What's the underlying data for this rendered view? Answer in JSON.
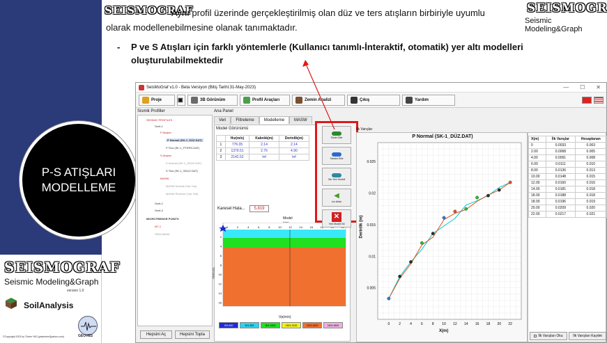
{
  "slide": {
    "brand": "SEISMOGRAF",
    "brand_sub": "Seismic Modeling&Graph",
    "intro_text_1": "Aynı profil üzerinde gerçekleştirilmiş olan düz ve ters atışların birbiriyle uyumlu",
    "intro_text_2": "olarak modellenebilmesine olanak tanımaktadır.",
    "bullet_dash": "-",
    "bullet_text_1": "P ve S Atışları için farklı yöntemlerle (Kullanıcı tanımlı-İnteraktif, otomatik)  yer altı modelleri",
    "bullet_text_2": "oluşturulabilmektedir",
    "circle_line_1": "P-S ATIŞLARI",
    "circle_line_2": "MODELLEME",
    "logo_brand": "SEISMOGRAF",
    "logo_sub": "Seismic Modeling&Graph",
    "logo_version": "version 1.0",
    "soil_label": "SoilAnalysis",
    "geoves": "GEOVES",
    "copyright": "©Copyright 2023 by Türker YAS (yasturker@yahoo.com)"
  },
  "app": {
    "title": "SeisMoGraf v1.0 - Beta Versiyon (Bitiş Tarihi:31-May-2023)",
    "toolbar": [
      "Proje",
      "3B Görünüm",
      "Profil Araçları",
      "Zemin Analizi",
      "Çıkış",
      "Yardım"
    ],
    "left_panel_title": "Sismik Profiller",
    "tree": [
      "SEISMIC PROFILES",
      "Serit-1",
      "P Atışları",
      "P Normal (SK-1_DÜZ.DAT)",
      "P Ters (SK-1_PTERS.DAT)",
      "S Atışları",
      "S Normal (SK-1_SDUZ.DAT)",
      "S Ters (SK-1_SDUZ.DAT)",
      "MASW",
      "MASW Normal (Yok Yok)",
      "MASW Reverse (Yok Yok)",
      "Serit-2",
      "Serit-3",
      "MICROTREMOR POINTS",
      "MT-1",
      "SPAC/MAM"
    ],
    "left_buttons": [
      "Hepsini Aç",
      "Hepsini Topla"
    ],
    "main_panel_title": "Ana Panel",
    "tabs": [
      "Veri",
      "Filtreleme",
      "Modelleme",
      "MASW"
    ],
    "model_view_title": "Model Görünümü",
    "table_headers": [
      "",
      "Hız(m/s)",
      "Kalınlık(m)",
      "Derinlik(m)"
    ],
    "table_rows": [
      [
        "1",
        "776.05",
        "2.14",
        "2.14"
      ],
      [
        "2",
        "1379.51",
        "2.76",
        "4.90"
      ],
      [
        "3",
        "2142.52",
        "Inf",
        "Inf"
      ]
    ],
    "error_label": "Karesel Hata...",
    "error_value": "5.819",
    "side_buttons": [
      "Sinde Ekle",
      "Tabaka Ekle",
      "Otu Yeni Modeli",
      "Ion Aktar",
      "Yeni Modeli Sil"
    ],
    "model_title": "Model",
    "model_xlabel": "X(m)",
    "model_ylabel": "Metre(m)",
    "model_bottom_label": "Vp(m/s)",
    "model_x_ticks": [
      "0",
      "2",
      "4",
      "6",
      "8",
      "10",
      "12",
      "14",
      "16",
      "18",
      "20",
      "22"
    ],
    "model_y_ticks": [
      "2",
      "4",
      "6",
      "8",
      "10",
      "12",
      "14",
      "16"
    ],
    "legend": [
      {
        "label": "200-600",
        "color": "#1e2ad4"
      },
      {
        "label": "601-800",
        "color": "#2ad4f0"
      },
      {
        "label": "801-1500",
        "color": "#22e022"
      },
      {
        "label": "1501-2100",
        "color": "#f0f020"
      },
      {
        "label": "2100-2400",
        "color": "#f07030"
      },
      {
        "label": "2400-2600",
        "color": "#f0b0e0"
      }
    ],
    "arrivals_title": "İlk Varışlar",
    "right_table_headers": [
      "X(m)",
      "İlk Varışlar",
      "Hesaplanan"
    ],
    "right_table_rows": [
      [
        "0",
        "0.0033",
        "0.003"
      ],
      [
        "2.00",
        "0.0068",
        "0.005"
      ],
      [
        "4.00",
        "0.0091",
        "0.008"
      ],
      [
        "6.00",
        "0.0111",
        "0.010"
      ],
      [
        "8.00",
        "0.0136",
        "0.013"
      ],
      [
        "10.00",
        "0.0148",
        "0.015"
      ],
      [
        "12.00",
        "0.0160",
        "0.016"
      ],
      [
        "14.00",
        "0.0181",
        "0.018"
      ],
      [
        "18.00",
        "0.0188",
        "0.018"
      ],
      [
        "18.00",
        "0.0196",
        "0.019"
      ],
      [
        "20.00",
        "0.0209",
        "0.020"
      ],
      [
        "22.00",
        "0.0217",
        "0.021"
      ]
    ],
    "right_buttons": [
      "İlk Varışları Oku",
      "İlk Varışları Kaydet"
    ]
  },
  "chart_data": {
    "type": "line",
    "title": "P  Normal  (SK-1_DÜZ.DAT)",
    "xlabel": "X(m)",
    "ylabel": "Derinlik (m)",
    "xlim": [
      -2,
      24
    ],
    "ylim": [
      0,
      0.028
    ],
    "x_ticks": [
      0,
      2,
      4,
      6,
      8,
      10,
      12,
      14,
      16,
      18,
      20,
      22
    ],
    "y_ticks": [
      0.005,
      0.01,
      0.015,
      0.02,
      0.025
    ],
    "grid": true,
    "series": [
      {
        "color": "#00c8c8",
        "x": [
          0,
          2,
          4,
          6,
          8,
          10,
          12,
          14,
          16,
          18,
          20,
          22
        ],
        "y": [
          0.0033,
          0.0068,
          0.0091,
          0.0111,
          0.0136,
          0.0148,
          0.016,
          0.0181,
          0.0188,
          0.0196,
          0.0209,
          0.0217
        ]
      },
      {
        "color": "#e05020",
        "x": [
          0,
          2,
          4,
          6,
          8,
          10,
          12,
          14,
          16,
          18,
          20,
          22
        ],
        "y": [
          0.0033,
          0.0065,
          0.0088,
          0.0118,
          0.013,
          0.0158,
          0.0168,
          0.0174,
          0.0187,
          0.0197,
          0.0205,
          0.0217
        ]
      }
    ],
    "markers": [
      {
        "x": 0,
        "y": 0.0033,
        "color": "#2a7ad8"
      },
      {
        "x": 2,
        "y": 0.0068,
        "color": "#2a2a2a"
      },
      {
        "x": 4,
        "y": 0.0091,
        "color": "#2a2a2a"
      },
      {
        "x": 6,
        "y": 0.0121,
        "color": "#22c022"
      },
      {
        "x": 8,
        "y": 0.0136,
        "color": "#2a2a2a"
      },
      {
        "x": 10,
        "y": 0.0161,
        "color": "#2a7ad8"
      },
      {
        "x": 12,
        "y": 0.0171,
        "color": "#e05020"
      },
      {
        "x": 14,
        "y": 0.0175,
        "color": "#22c022"
      },
      {
        "x": 16,
        "y": 0.0193,
        "color": "#22c022"
      },
      {
        "x": 18,
        "y": 0.0196,
        "color": "#2a2a2a"
      },
      {
        "x": 20,
        "y": 0.0205,
        "color": "#2a2a2a"
      },
      {
        "x": 22,
        "y": 0.0217,
        "color": "#e05020"
      }
    ]
  }
}
